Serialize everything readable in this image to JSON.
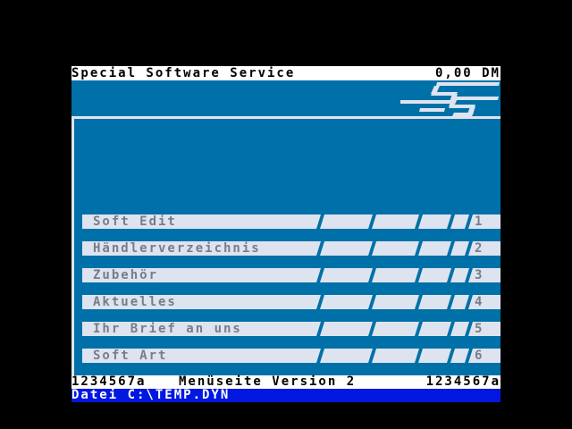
{
  "header": {
    "title": "Special Software Service",
    "balance": "0,00 DM"
  },
  "logo": {
    "icon": "sss-logo-icon",
    "text": "SSS"
  },
  "menu": {
    "items": [
      {
        "label": "Soft Edit",
        "number": "1"
      },
      {
        "label": "Händlerverzeichnis",
        "number": "2"
      },
      {
        "label": "Zubehör",
        "number": "3"
      },
      {
        "label": "Aktuelles",
        "number": "4"
      },
      {
        "label": "Ihr Brief an uns",
        "number": "5"
      },
      {
        "label": "Soft Art",
        "number": "6"
      }
    ]
  },
  "status": {
    "left_code": "1234567a",
    "page_label": "Menüseite Version 2",
    "right_code": "1234567a"
  },
  "file": {
    "path": "Datei C:\\TEMP.DYN"
  },
  "colors": {
    "background": "#000000",
    "panel": "#0070a8",
    "menu_bar": "#dde4f0",
    "menu_text": "#777c88",
    "file_bar": "#0018e0"
  }
}
